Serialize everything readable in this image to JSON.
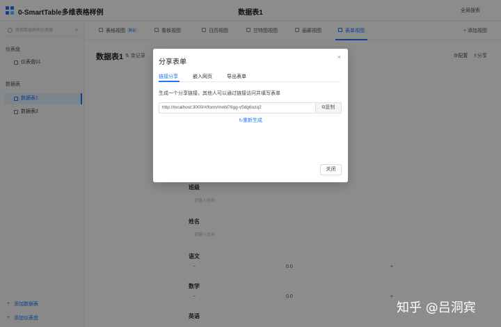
{
  "app": {
    "title": "0-SmartTable多维表格样例",
    "center_title": "数据表1",
    "right_label": "全局搜索"
  },
  "sidebar": {
    "search_placeholder": "搜索数据表和仪表盘",
    "dashboard_section": "仪表盘",
    "dashboards": [
      {
        "label": "仪表盘01"
      }
    ],
    "table_section": "数据表",
    "tables": [
      {
        "label": "数据表1",
        "active": true
      },
      {
        "label": "数据表2",
        "active": false
      }
    ],
    "bottom": [
      {
        "label": "添加数据表"
      },
      {
        "label": "添加仪表盘"
      }
    ]
  },
  "tabs": {
    "items": [
      {
        "label": "表格视图",
        "badge": "默认"
      },
      {
        "label": "看板视图"
      },
      {
        "label": "日历视图"
      },
      {
        "label": "甘特图视图"
      },
      {
        "label": "画廊视图"
      },
      {
        "label": "表单视图",
        "active": true
      }
    ],
    "add_label": "+ 添加视图"
  },
  "content": {
    "title": "数据表1",
    "log_label": "变记录",
    "config_label": "配置",
    "share_label": "分享"
  },
  "form": {
    "fields": [
      {
        "label": "班级",
        "placeholder": "请输入班级"
      },
      {
        "label": "姓名",
        "placeholder": "请输入姓名"
      }
    ],
    "steppers": [
      {
        "label": "语文",
        "value": "0.0"
      },
      {
        "label": "数学",
        "value": "0.0"
      }
    ],
    "last_label": "英语"
  },
  "modal": {
    "title": "分享表单",
    "close_icon": "×",
    "tabs": [
      "链接分享",
      "嵌入网页",
      "导出表单"
    ],
    "description": "生成一个分享链接，其他人可以通过链接访问并填写表单",
    "link_value": "http://localhost:3000/#/form/mnbl76gg-v5dg6ozq2",
    "copy_label": "复制",
    "regen_label": "重新生成",
    "close_label": "关闭"
  },
  "watermark": "知乎 @吕洞宾"
}
